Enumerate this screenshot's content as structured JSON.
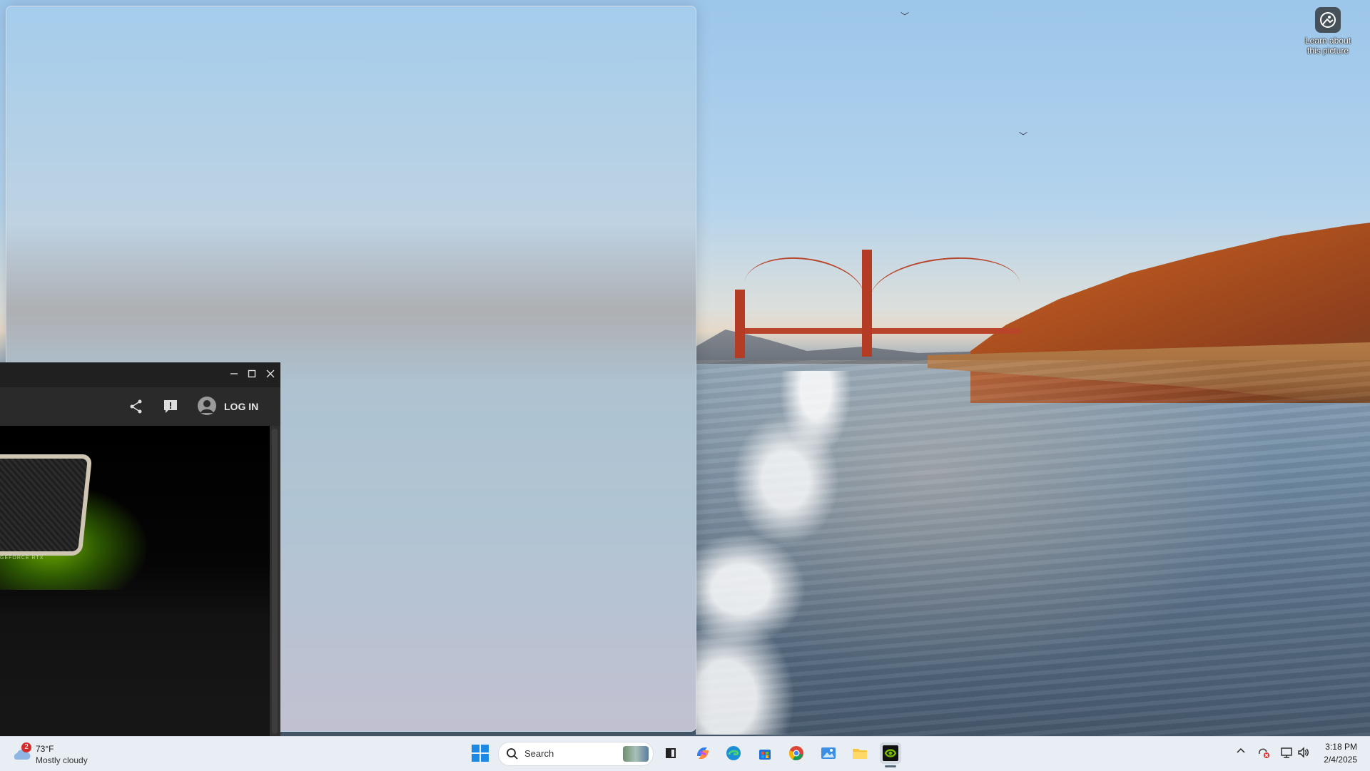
{
  "desktop": {
    "learn_picture_label": "Learn about this picture"
  },
  "app_window": {
    "header": {
      "login_label": "LOG IN"
    },
    "content": {
      "gpu_label": "GEFORCE RTX"
    }
  },
  "taskbar": {
    "weather": {
      "badge_count": "2",
      "temperature": "73°F",
      "condition": "Mostly cloudy"
    },
    "search": {
      "placeholder": "Search"
    },
    "clock": {
      "time": "3:18 PM",
      "date": "2/4/2025"
    }
  }
}
